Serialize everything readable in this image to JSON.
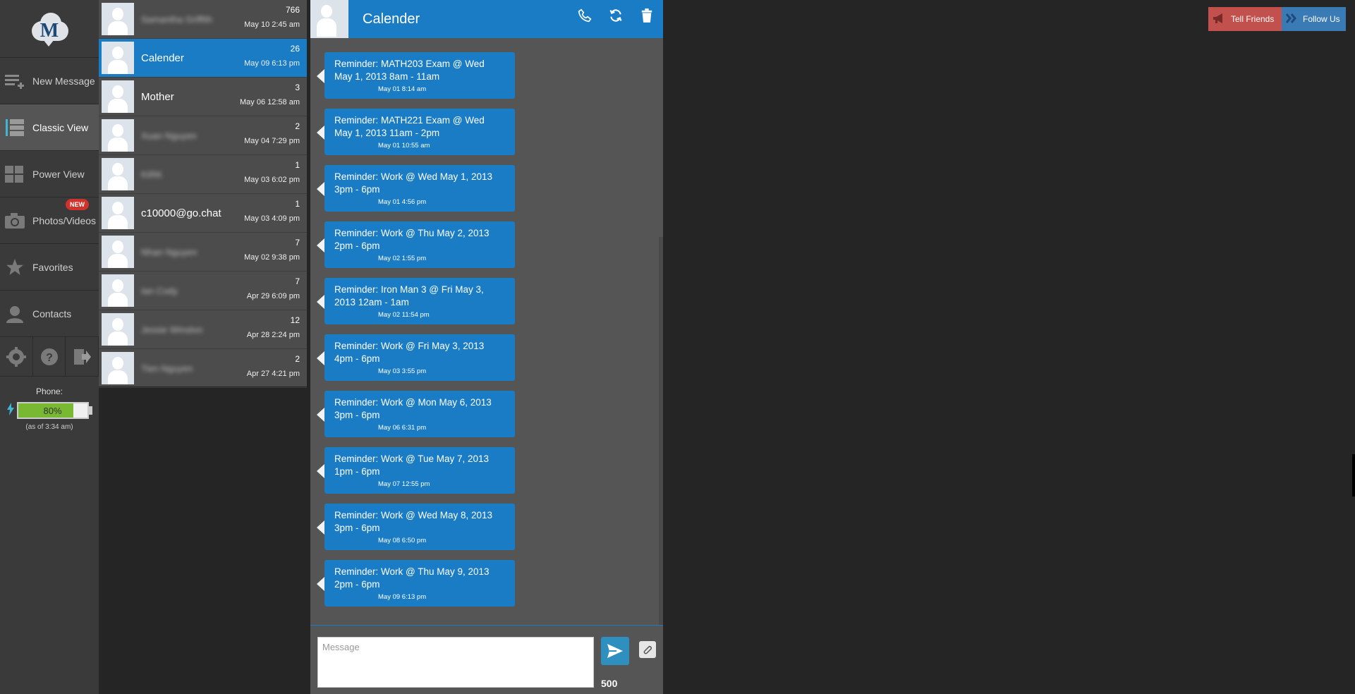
{
  "nav": {
    "logo_letter": "M",
    "items": [
      {
        "label": "New Message"
      },
      {
        "label": "Classic View"
      },
      {
        "label": "Power View"
      },
      {
        "label": "Photos/Videos",
        "badge": "NEW"
      },
      {
        "label": "Favorites"
      },
      {
        "label": "Contacts"
      }
    ],
    "tools": [
      "settings-icon",
      "help-icon",
      "logout-icon"
    ],
    "phone": {
      "label": "Phone:",
      "battery": "80%",
      "battery_level": 0.8,
      "as_of": "(as of 3:34 am)"
    }
  },
  "conversations": [
    {
      "name": "Samantha Griffith",
      "blurred": true,
      "count": "766",
      "time": "May 10 2:45 am"
    },
    {
      "name": "Calender",
      "blurred": false,
      "count": "26",
      "time": "May 09 6:13 pm",
      "active": true
    },
    {
      "name": "Mother",
      "blurred": false,
      "count": "3",
      "time": "May 06 12:58 am"
    },
    {
      "name": "Xuan Nguyen",
      "blurred": true,
      "count": "2",
      "time": "May 04 7:29 pm"
    },
    {
      "name": "KIRK",
      "blurred": true,
      "count": "1",
      "time": "May 03 6:02 pm"
    },
    {
      "name": "c10000@go.chat",
      "blurred": false,
      "count": "1",
      "time": "May 03 4:09 pm"
    },
    {
      "name": "Nhan Nguyen",
      "blurred": true,
      "count": "7",
      "time": "May 02 9:38 pm"
    },
    {
      "name": "Ian Cody",
      "blurred": true,
      "count": "7",
      "time": "Apr 29 6:09 pm"
    },
    {
      "name": "Jessie Winston",
      "blurred": true,
      "count": "12",
      "time": "Apr 28 2:24 pm"
    },
    {
      "name": "Tien Nguyen",
      "blurred": true,
      "count": "2",
      "time": "Apr 27 4:21 pm"
    }
  ],
  "chat": {
    "title": "Calender",
    "messages": [
      {
        "text": "Reminder: MATH203 Exam @ Wed May 1, 2013 8am - 11am",
        "time": "May 01 8:14 am"
      },
      {
        "text": "Reminder: MATH221 Exam @ Wed May 1, 2013 11am - 2pm",
        "time": "May 01 10:55 am"
      },
      {
        "text": "Reminder: Work @ Wed May 1, 2013 3pm - 6pm",
        "time": "May 01 4:56 pm"
      },
      {
        "text": "Reminder: Work @ Thu May 2, 2013 2pm - 6pm",
        "time": "May 02 1:55 pm"
      },
      {
        "text": "Reminder: Iron Man 3 @ Fri May 3, 2013 12am - 1am",
        "time": "May 02 11:54 pm"
      },
      {
        "text": "Reminder: Work @ Fri May 3, 2013 4pm - 6pm",
        "time": "May 03 3:55 pm"
      },
      {
        "text": "Reminder: Work @ Mon May 6, 2013 3pm - 6pm",
        "time": "May 06 6:31 pm"
      },
      {
        "text": "Reminder: Work @ Tue May 7, 2013 1pm - 6pm",
        "time": "May 07 12:55 pm"
      },
      {
        "text": "Reminder: Work @ Wed May 8, 2013 3pm - 6pm",
        "time": "May 08 6:50 pm"
      },
      {
        "text": "Reminder: Work @ Thu May 9, 2013 2pm - 6pm",
        "time": "May 09 6:13 pm"
      }
    ],
    "compose": {
      "placeholder": "Message",
      "char_count": "500"
    }
  },
  "top": {
    "tell_friends": "Tell Friends",
    "follow_us": "Follow Us"
  },
  "colors": {
    "accent": "#1a7cc4",
    "battery": "#78b832",
    "tell_friends": "#c2504c",
    "follow_us": "#3a7ab5"
  }
}
